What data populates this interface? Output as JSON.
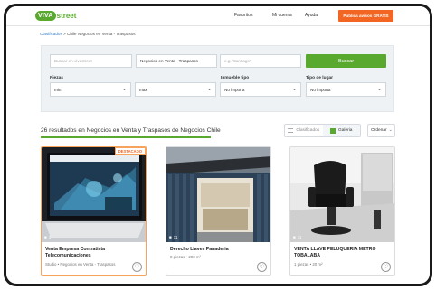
{
  "header": {
    "logo_viva": "VIVA",
    "logo_street": "street",
    "nav": [
      "Favoritos",
      "Mi cuenta",
      "Ayuda"
    ],
    "post_button": "Publica avisos GRATIS"
  },
  "breadcrumb": {
    "home": "Clasificados",
    "separator": ">",
    "current": "Chile Negocios en Venta - Traspasos"
  },
  "search": {
    "keyword_placeholder": "Buscar en vivastreet",
    "category_value": "Negocios en Venta - Traspasos",
    "location_placeholder": "e.g. 'Santiago'",
    "search_button": "Buscar",
    "filters": [
      {
        "label": "Piezas",
        "value": "min"
      },
      {
        "label": "",
        "value": "max"
      },
      {
        "label": "Inmueble tipo",
        "value": "No importa"
      },
      {
        "label": "Tipo de lugar",
        "value": "No importa"
      }
    ]
  },
  "results": {
    "heading": "26 resultados en Negocios en Venta y Traspasos de Negocios Chile",
    "view_list": "Clasificados",
    "view_gallery": "Galeria",
    "order": "Ordenar",
    "accent": "#5aa92f"
  },
  "listings": [
    {
      "badge": "DESTACADO",
      "photos": "1",
      "title": "Venta Empresa Contratista Telecomunicaciones",
      "meta": "Studio • Negocios en Venta - Traspasos"
    },
    {
      "badge": "",
      "photos": "11",
      "title": "Derecho Llaves Panaderia",
      "meta": "8 piezas • 200 m²"
    },
    {
      "badge": "",
      "photos": "11",
      "title": "VENTA LLAVE PELUQUERIA METRO TOBALABA",
      "meta": "1 piezas • 20 m²"
    }
  ]
}
